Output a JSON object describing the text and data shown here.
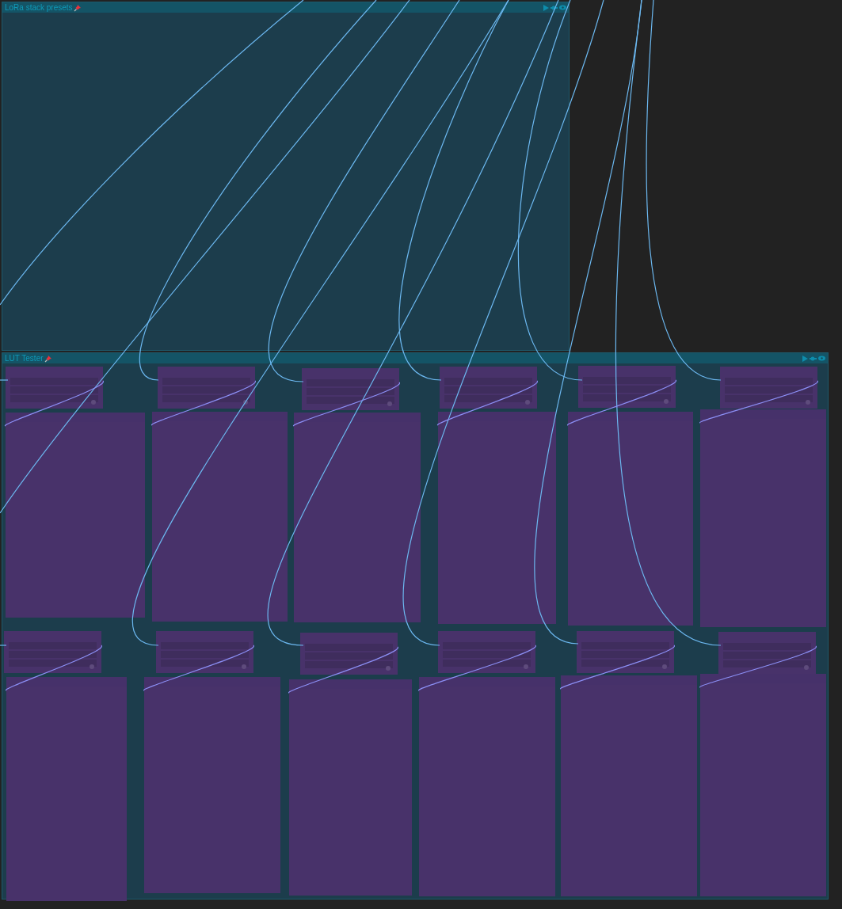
{
  "canvas": {
    "groups": [
      {
        "title": "LoRa stack presets",
        "pinned": true
      },
      {
        "title": "LUT Tester",
        "pinned": true
      }
    ]
  }
}
